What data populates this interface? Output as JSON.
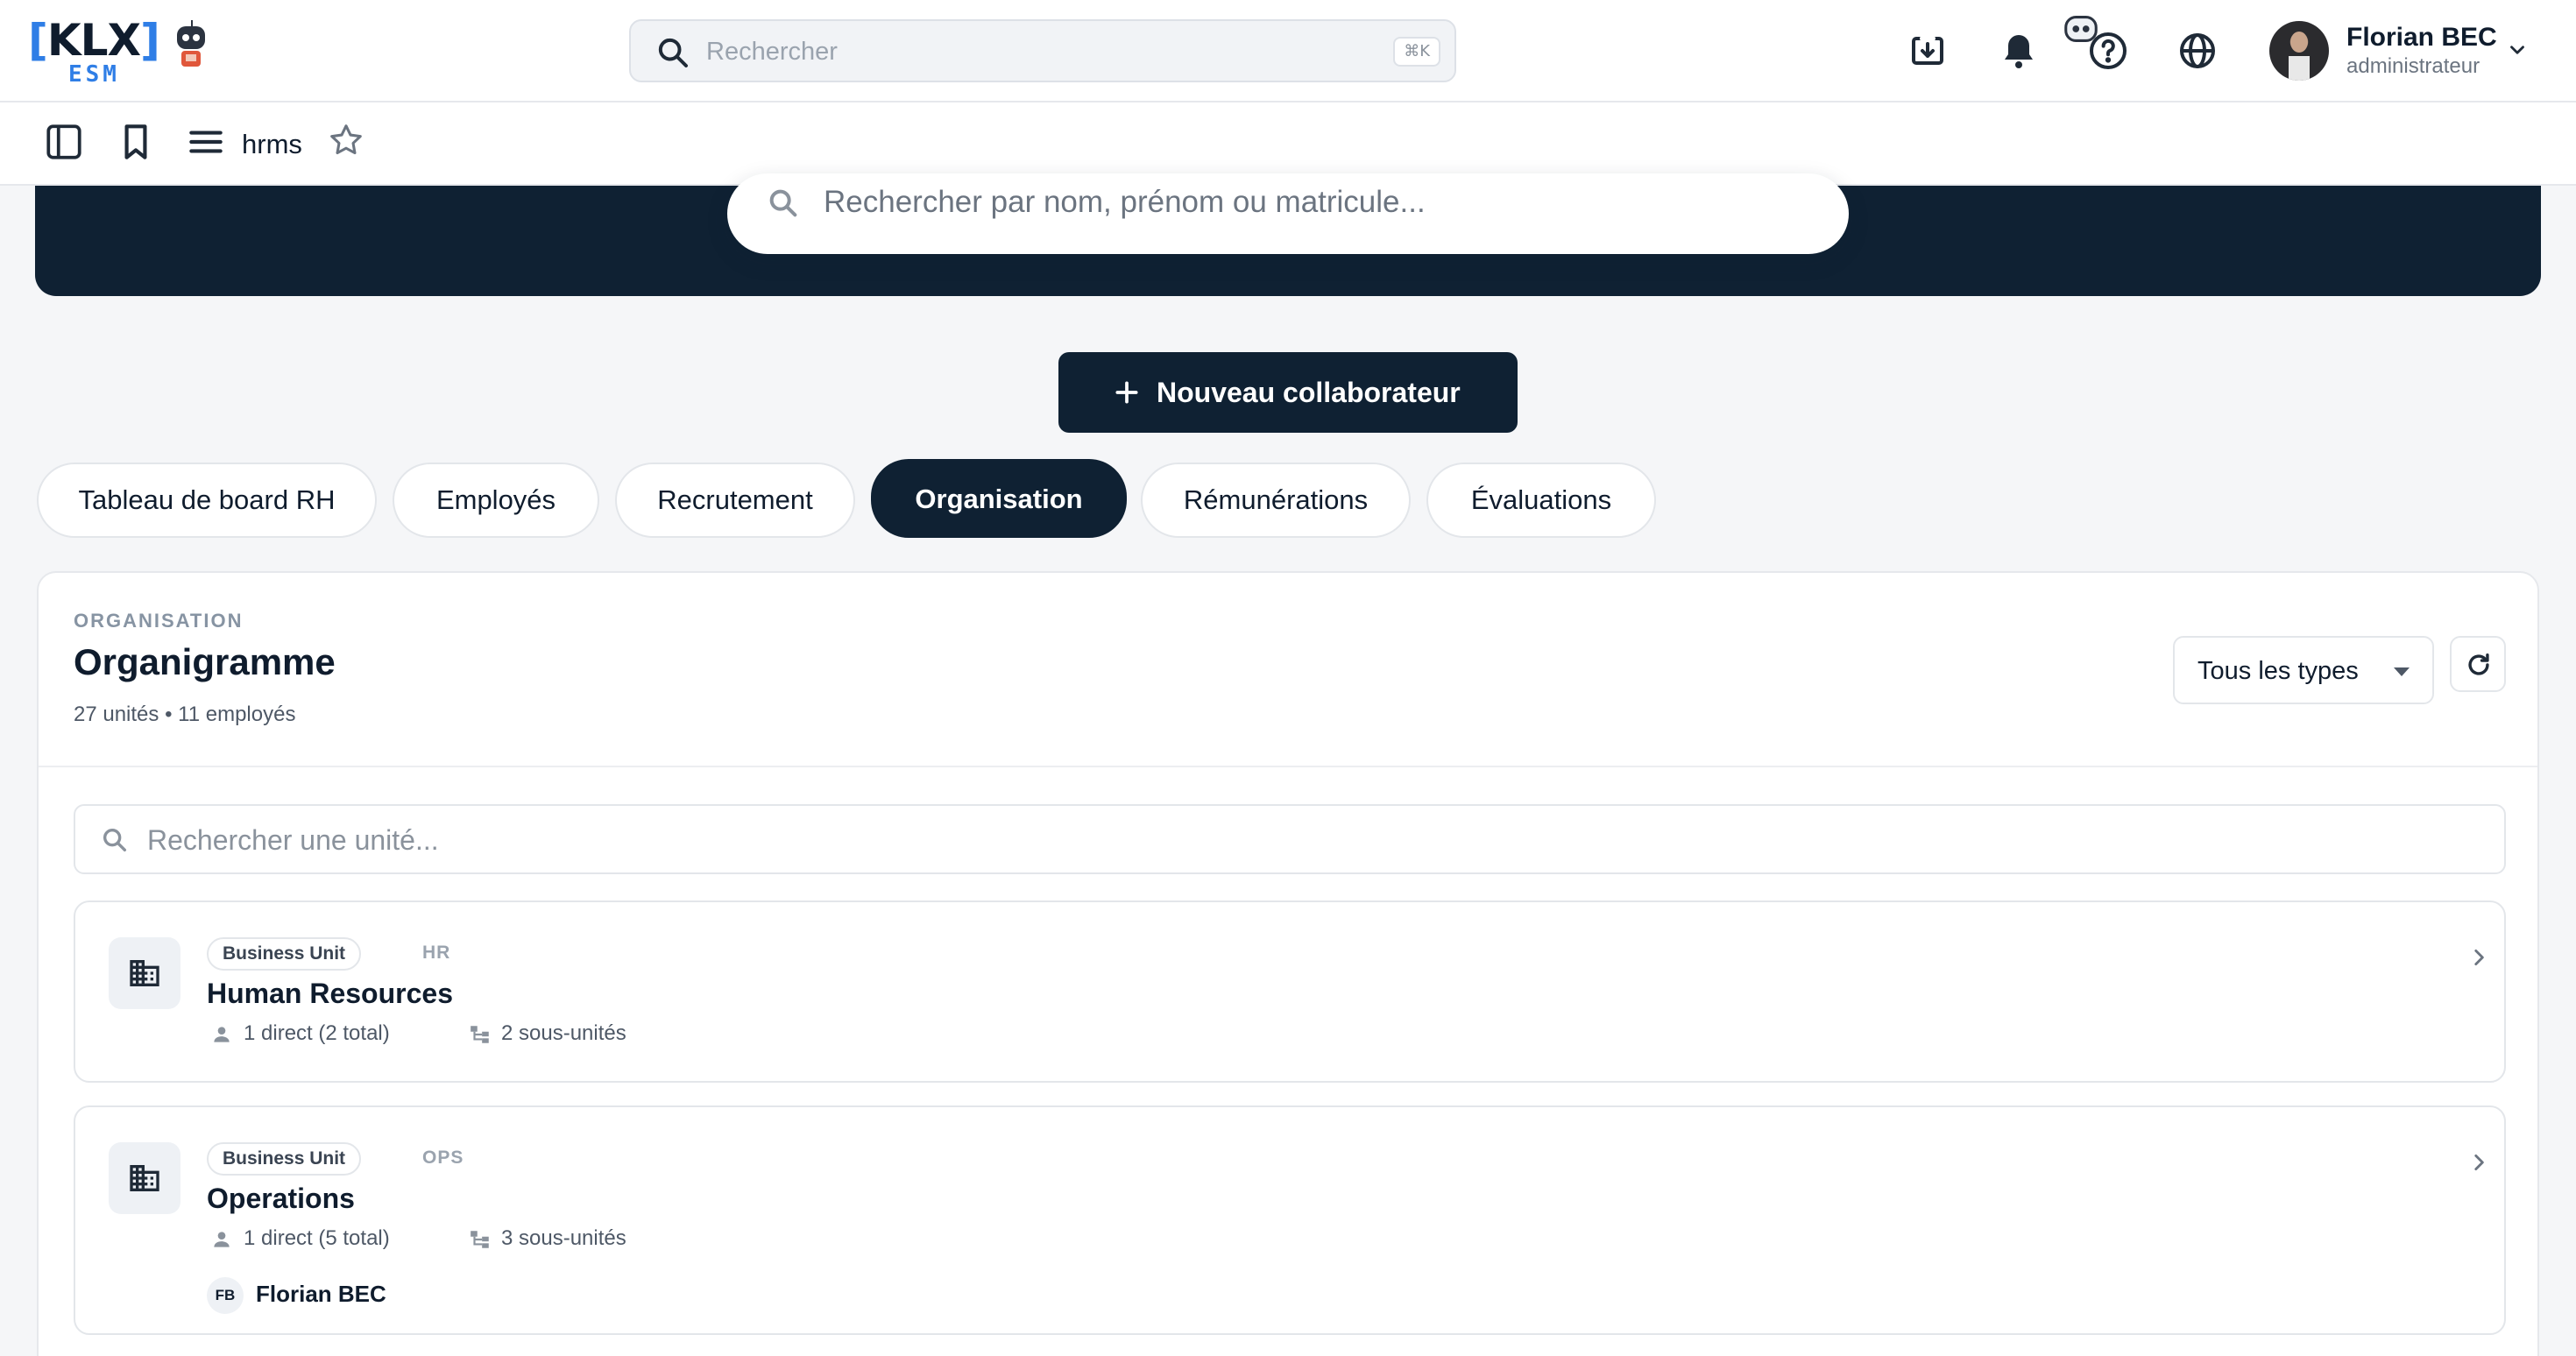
{
  "app": {
    "logo_text": "[KLX]",
    "logo_sub": "ESM"
  },
  "topbar": {
    "search_placeholder": "Rechercher",
    "search_shortcut": "⌘K",
    "icons": [
      "download-icon",
      "bell-icon",
      "assistant-robot-icon",
      "help-icon",
      "globe-icon"
    ],
    "user": {
      "name": "Florian BEC",
      "role": "administrateur"
    }
  },
  "subbar": {
    "module_label": "hrms"
  },
  "hero": {
    "search_placeholder": "Rechercher par nom, prénom ou matricule..."
  },
  "actions": {
    "new_collaborator": "Nouveau collaborateur"
  },
  "tabs": [
    {
      "label": "Tableau de board RH",
      "active": false
    },
    {
      "label": "Employés",
      "active": false
    },
    {
      "label": "Recrutement",
      "active": false
    },
    {
      "label": "Organisation",
      "active": true
    },
    {
      "label": "Rémunérations",
      "active": false
    },
    {
      "label": "Évaluations",
      "active": false
    }
  ],
  "panel": {
    "eyebrow": "ORGANISATION",
    "title": "Organigramme",
    "subtitle": "27 unités • 11 employés",
    "type_filter": "Tous les types",
    "unit_search_placeholder": "Rechercher une unité..."
  },
  "units": [
    {
      "type": "Business Unit",
      "code": "HR",
      "name": "Human Resources",
      "direct": "1 direct (2 total)",
      "subunits": "2 sous-unités"
    },
    {
      "type": "Business Unit",
      "code": "OPS",
      "name": "Operations",
      "direct": "1 direct (5 total)",
      "subunits": "3 sous-unités",
      "manager": {
        "initials": "FB",
        "name": "Florian BEC"
      }
    }
  ],
  "colors": {
    "navy": "#0f2133",
    "accent_blue": "#2f7ee6",
    "background": "#f5f6f8"
  }
}
